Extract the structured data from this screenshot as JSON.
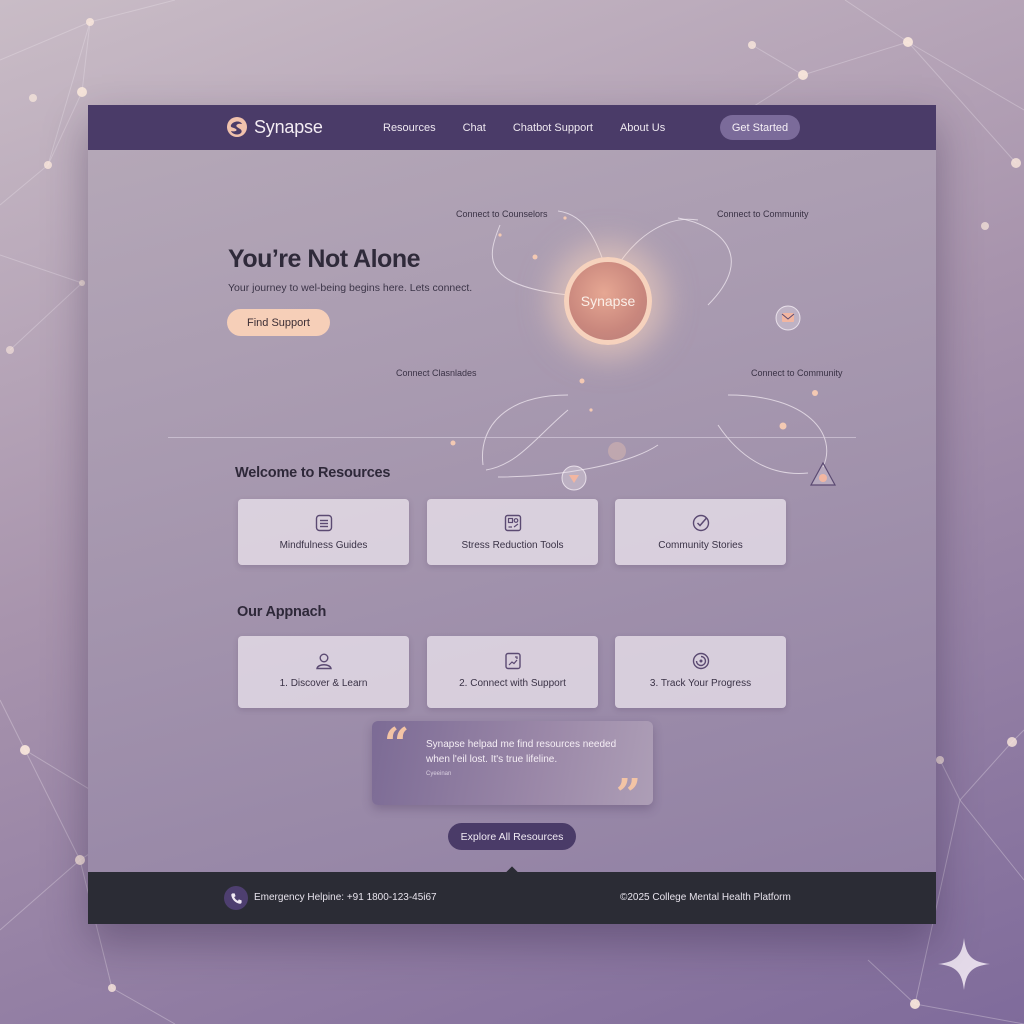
{
  "nav": {
    "brand": "Synapse",
    "links": [
      "Resources",
      "Chat",
      "Chatbot Support",
      "About Us"
    ],
    "cta": "Get Started"
  },
  "hero": {
    "title": "You’re Not Alone",
    "subtitle": "Your journey to wel-being begins here. Lets connect.",
    "button": "Find Support",
    "hub_label": "Synapse",
    "nodes": {
      "top_left": "Connect to Counselors",
      "top_right": "Connect to Community",
      "bottom_left": "Connect Clasnlades",
      "bottom_right": "Connect to Community"
    }
  },
  "resources": {
    "title": "Welcome to Resources",
    "cards": [
      {
        "label": "Mindfulness Guides",
        "icon": "list-icon"
      },
      {
        "label": "Stress Reduction Tools",
        "icon": "tools-icon"
      },
      {
        "label": "Community Stories",
        "icon": "shield-check-icon"
      }
    ]
  },
  "approach": {
    "title": "Our Appnach",
    "cards": [
      {
        "label": "1. Discover & Learn",
        "icon": "user-icon"
      },
      {
        "label": "2. Connect with Support",
        "icon": "document-icon"
      },
      {
        "label": "3. Track Your Progress",
        "icon": "progress-icon"
      }
    ]
  },
  "testimonial": {
    "quote": "Synapse helpad me find resources needed when l'eil lost. It's true lifeline.",
    "author": "Cyeeinan"
  },
  "explore_button": "Explore All Resources",
  "footer": {
    "helpline": "Emergency Helpine: +91 1800-123-45i67",
    "copyright": "©2025 College Mental Health Platform"
  },
  "colors": {
    "nav_bg": "#4a3b68",
    "accent_peach": "#f6cfb8",
    "footer_bg": "#2b2c35"
  }
}
